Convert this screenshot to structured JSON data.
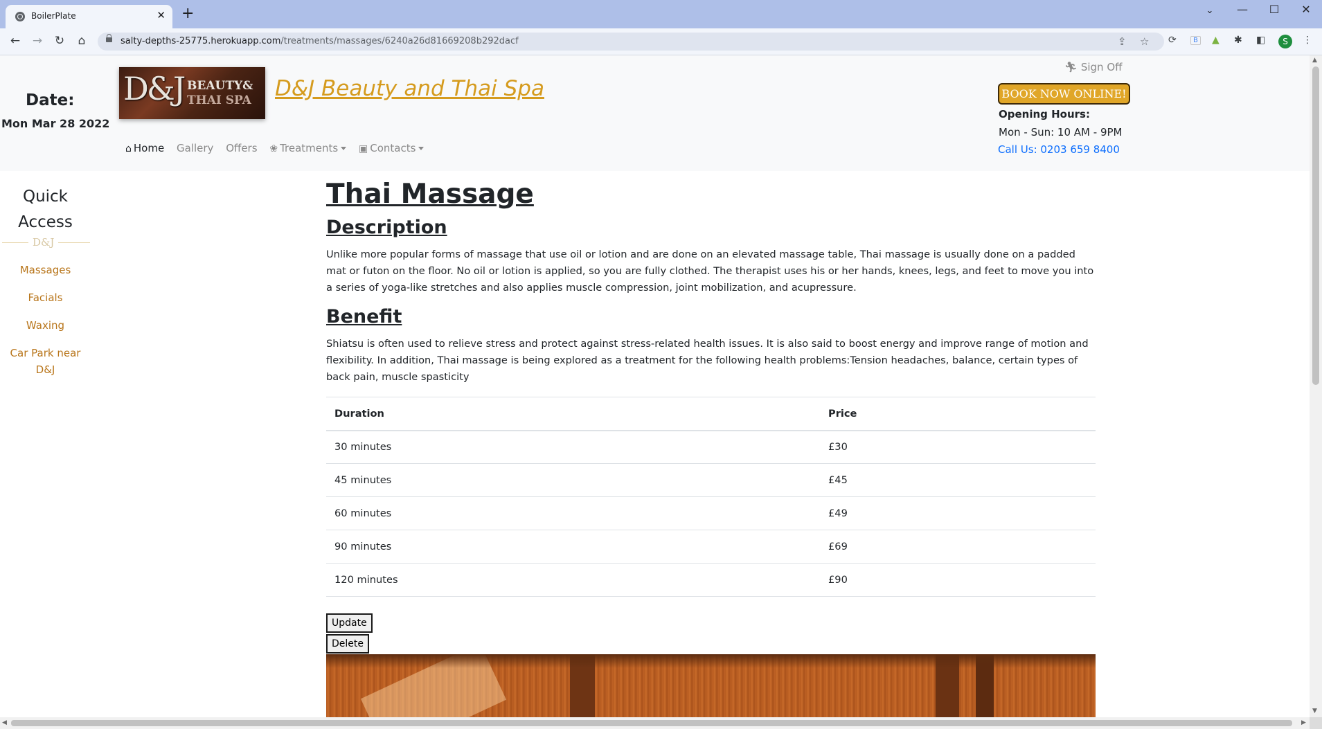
{
  "browser": {
    "tab_title": "BoilerPlate",
    "url_host": "salty-depths-25775.herokuapp.com",
    "url_path": "/treatments/massages/6240a26d81669208b292dacf",
    "profile_initial": "S"
  },
  "header": {
    "date_label": "Date:",
    "date_value": "Mon Mar 28 2022",
    "logo_dj": "D&J",
    "logo_line1": "BEAUTY&",
    "logo_line2": "THAI SPA",
    "brand": " D&J Beauty and Thai Spa",
    "nav": {
      "home": "Home",
      "gallery": "Gallery",
      "offers": "Offers",
      "treatments": "Treatments",
      "contacts": "Contacts"
    },
    "sign_off": "Sign Off",
    "book_now": "BOOK NOW ONLINE!",
    "hours_title": "Opening Hours:",
    "hours_value": "Mon - Sun: 10 AM - 9PM",
    "call": "Call Us: 0203 659 8400",
    "accent_color": "#e0a628",
    "brand_color": "#d59b1e"
  },
  "sidebar": {
    "title_line1": "Quick",
    "title_line2": "Access",
    "divider_text": "D&J",
    "links": [
      "Massages",
      "Facials",
      "Waxing",
      "Car Park near",
      "D&J"
    ]
  },
  "main": {
    "title": "Thai Massage",
    "description_heading": "Description",
    "description_text": "Unlike more popular forms of massage that use oil or lotion and are done on an elevated massage table, Thai massage is usually done on a padded mat or futon on the floor. No oil or lotion is applied, so you are fully clothed. The therapist uses his or her hands, knees, legs, and feet to move you into a series of yoga-like stretches and also applies muscle compression, joint mobilization, and acupressure.",
    "benefit_heading": "Benefit",
    "benefit_text": "Shiatsu is often used to relieve stress and protect against stress-related health issues. It is also said to boost energy and improve range of motion and flexibility. In addition, Thai massage is being explored as a treatment for the following health problems:Tension headaches, balance, certain types of back pain, muscle spasticity",
    "table": {
      "headers": [
        "Duration",
        "Price"
      ],
      "rows": [
        [
          "30 minutes",
          "£30"
        ],
        [
          "45 minutes",
          "£45"
        ],
        [
          "60 minutes",
          "£49"
        ],
        [
          "90 minutes",
          "£69"
        ],
        [
          "120 minutes",
          "£90"
        ]
      ]
    },
    "update_label": "Update",
    "delete_label": "Delete"
  }
}
